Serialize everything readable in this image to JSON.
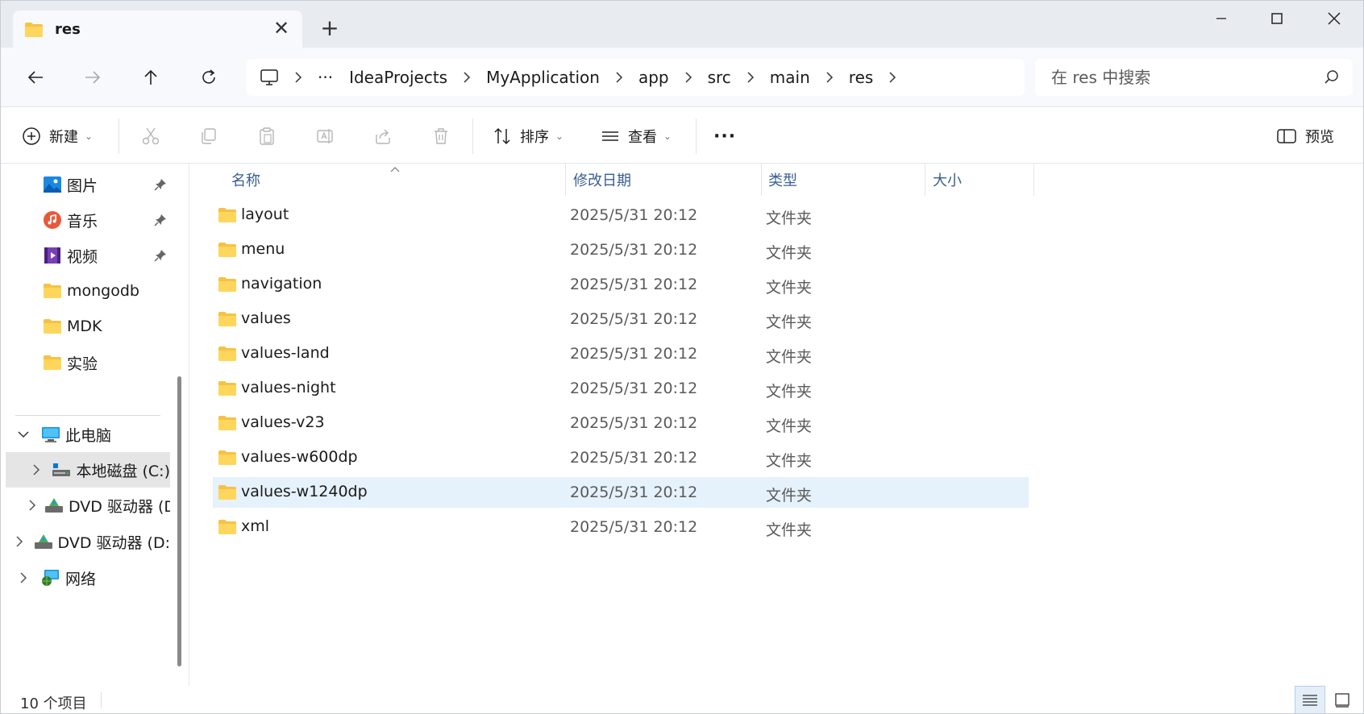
{
  "tab": {
    "title": "res",
    "close": "✕",
    "new": "+"
  },
  "address": {
    "overflow": "···",
    "crumbs": [
      "IdeaProjects",
      "MyApplication",
      "app",
      "src",
      "main",
      "res"
    ]
  },
  "search": {
    "placeholder": "在 res 中搜索"
  },
  "toolbar": {
    "new_label": "新建",
    "sort_label": "排序",
    "view_label": "查看",
    "more_label": "···",
    "preview_label": "预览"
  },
  "sidebar": {
    "quick": [
      {
        "label": "图片",
        "icon": "pictures-icon",
        "pinned": true
      },
      {
        "label": "音乐",
        "icon": "music-icon",
        "pinned": true
      },
      {
        "label": "视频",
        "icon": "videos-icon",
        "pinned": true
      },
      {
        "label": "mongodb",
        "icon": "folder-icon",
        "pinned": false
      },
      {
        "label": "MDK",
        "icon": "folder-icon",
        "pinned": false
      },
      {
        "label": "实验",
        "icon": "folder-icon",
        "pinned": false
      }
    ],
    "this_pc": "此电脑",
    "local_disk": "本地磁盘 (C:)",
    "dvd_1": "DVD 驱动器 (D:",
    "dvd_2": "DVD 驱动器 (D:",
    "network": "网络"
  },
  "columns": {
    "name": "名称",
    "date": "修改日期",
    "type": "类型",
    "size": "大小"
  },
  "files": [
    {
      "name": "layout",
      "date": "2025/5/31 20:12",
      "type": "文件夹"
    },
    {
      "name": "menu",
      "date": "2025/5/31 20:12",
      "type": "文件夹"
    },
    {
      "name": "navigation",
      "date": "2025/5/31 20:12",
      "type": "文件夹"
    },
    {
      "name": "values",
      "date": "2025/5/31 20:12",
      "type": "文件夹"
    },
    {
      "name": "values-land",
      "date": "2025/5/31 20:12",
      "type": "文件夹"
    },
    {
      "name": "values-night",
      "date": "2025/5/31 20:12",
      "type": "文件夹"
    },
    {
      "name": "values-v23",
      "date": "2025/5/31 20:12",
      "type": "文件夹"
    },
    {
      "name": "values-w600dp",
      "date": "2025/5/31 20:12",
      "type": "文件夹"
    },
    {
      "name": "values-w1240dp",
      "date": "2025/5/31 20:12",
      "type": "文件夹",
      "selected": true
    },
    {
      "name": "xml",
      "date": "2025/5/31 20:12",
      "type": "文件夹"
    }
  ],
  "status": {
    "count": "10 个项目"
  },
  "colors": {
    "accent": "#0067c0",
    "selection": "#e5f1fb",
    "folder": "#f5c244"
  }
}
